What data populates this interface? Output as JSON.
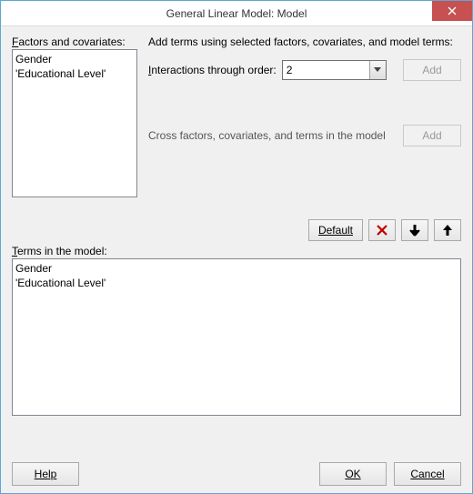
{
  "window": {
    "title": "General Linear Model: Model"
  },
  "factors": {
    "label": "Factors and covariates:",
    "items": [
      "Gender",
      "'Educational Level'"
    ]
  },
  "instructions": "Add terms using selected factors, covariates, and model terms:",
  "interactions": {
    "label": "Interactions through order:",
    "value": "2",
    "add_label": "Add"
  },
  "cross": {
    "label": "Cross factors, covariates, and terms in the model",
    "add_label": "Add"
  },
  "toolbar": {
    "default_label": "Default"
  },
  "terms": {
    "label": "Terms in the model:",
    "items": [
      "Gender",
      "'Educational Level'"
    ]
  },
  "buttons": {
    "help": "Help",
    "ok": "OK",
    "cancel": "Cancel"
  }
}
